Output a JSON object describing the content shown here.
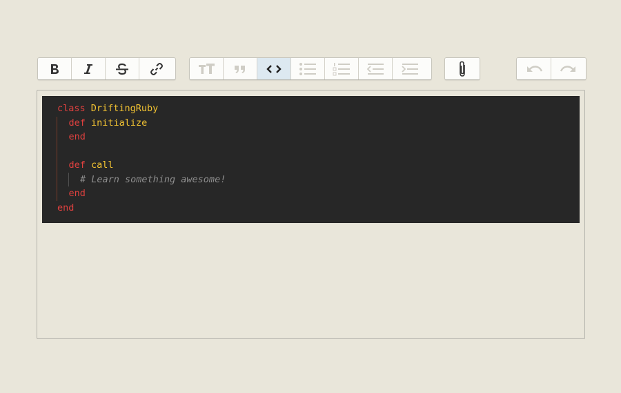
{
  "toolbar": {
    "text_tools": [
      {
        "name": "bold-button",
        "icon": "bold-icon",
        "enabled": true
      },
      {
        "name": "italic-button",
        "icon": "italic-icon",
        "enabled": true
      },
      {
        "name": "strikethrough-button",
        "icon": "strikethrough-icon",
        "enabled": true
      },
      {
        "name": "link-button",
        "icon": "link-icon",
        "enabled": true
      }
    ],
    "block_tools": [
      {
        "name": "heading-button",
        "icon": "heading-icon",
        "enabled": false
      },
      {
        "name": "quote-button",
        "icon": "quote-icon",
        "enabled": false
      },
      {
        "name": "code-button",
        "icon": "code-icon",
        "enabled": true,
        "active": true
      },
      {
        "name": "bullet-list-button",
        "icon": "bullet-list-icon",
        "enabled": false
      },
      {
        "name": "numbered-list-button",
        "icon": "numbered-list-icon",
        "enabled": false
      },
      {
        "name": "decrease-indent-button",
        "icon": "outdent-icon",
        "enabled": false
      },
      {
        "name": "increase-indent-button",
        "icon": "indent-icon",
        "enabled": false
      }
    ],
    "file_tools": [
      {
        "name": "attach-file-button",
        "icon": "paperclip-icon",
        "enabled": true
      }
    ],
    "history_tools": [
      {
        "name": "undo-button",
        "icon": "undo-icon",
        "enabled": false
      },
      {
        "name": "redo-button",
        "icon": "redo-icon",
        "enabled": false
      }
    ]
  },
  "editor": {
    "code_lines": [
      {
        "indent": 0,
        "parts": [
          {
            "t": "class ",
            "k": "kw"
          },
          {
            "t": "DriftingRuby",
            "k": "nm"
          }
        ]
      },
      {
        "indent": 1,
        "parts": [
          {
            "t": "def ",
            "k": "kw"
          },
          {
            "t": "initialize",
            "k": "nm"
          }
        ]
      },
      {
        "indent": 1,
        "parts": [
          {
            "t": "end",
            "k": "kw"
          }
        ]
      },
      {
        "indent": 0,
        "parts": []
      },
      {
        "indent": 1,
        "parts": [
          {
            "t": "def ",
            "k": "kw"
          },
          {
            "t": "call",
            "k": "nm"
          }
        ]
      },
      {
        "indent": 2,
        "parts": [
          {
            "t": "# Learn something awesome!",
            "k": "cm"
          }
        ]
      },
      {
        "indent": 1,
        "parts": [
          {
            "t": "end",
            "k": "kw"
          }
        ]
      },
      {
        "indent": 0,
        "parts": [
          {
            "t": "end",
            "k": "kw"
          }
        ]
      }
    ]
  },
  "colors": {
    "background": "#e9e6da",
    "code_background": "#272727",
    "keyword": "#e0413f",
    "identifier": "#f1c232",
    "comment": "#8e8e8e",
    "active_button": "#dde9f1"
  }
}
